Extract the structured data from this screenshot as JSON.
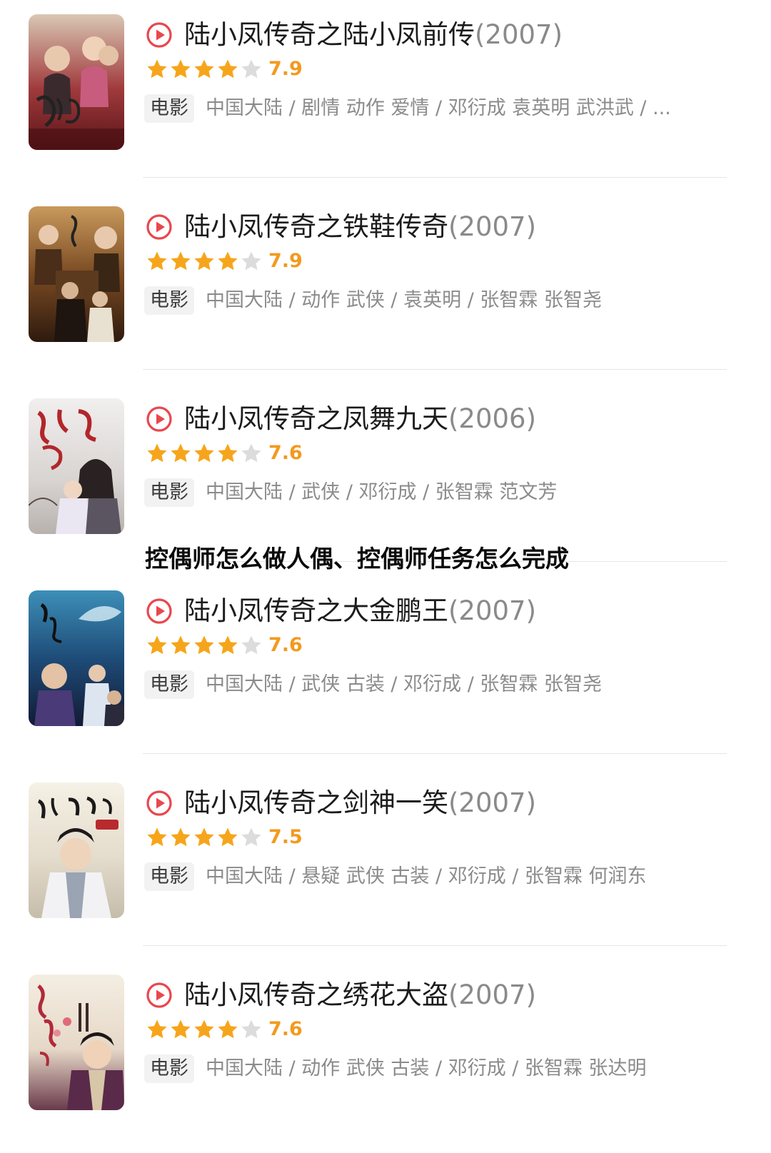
{
  "overlay_heading": "控偶师怎么做人偶、控偶师任务怎么完成",
  "colors": {
    "accent_play": "#e9474c",
    "star_filled": "#f6a51b",
    "star_empty": "#dcdcdc",
    "rating_text": "#f39a1e"
  },
  "icons": {
    "play": "play-circle-icon",
    "star": "star-icon"
  },
  "movies": [
    {
      "title": "陆小凤传奇之陆小凤前传",
      "year": "(2007)",
      "stars_filled": 4,
      "stars_total": 5,
      "rating": "7.9",
      "type": "电影",
      "meta": "中国大陆 / 剧情 动作 爱情 / 邓衍成 袁英明 武洪武 / ..."
    },
    {
      "title": "陆小凤传奇之铁鞋传奇",
      "year": "(2007)",
      "stars_filled": 4,
      "stars_total": 5,
      "rating": "7.9",
      "type": "电影",
      "meta": "中国大陆 / 动作 武侠 / 袁英明 / 张智霖 张智尧"
    },
    {
      "title": "陆小凤传奇之凤舞九天",
      "year": "(2006)",
      "stars_filled": 4,
      "stars_total": 5,
      "rating": "7.6",
      "type": "电影",
      "meta": "中国大陆 / 武侠 / 邓衍成 / 张智霖 范文芳"
    },
    {
      "title": "陆小凤传奇之大金鹏王",
      "year": "(2007)",
      "stars_filled": 4,
      "stars_total": 5,
      "rating": "7.6",
      "type": "电影",
      "meta": "中国大陆 / 武侠 古装 / 邓衍成 / 张智霖 张智尧"
    },
    {
      "title": "陆小凤传奇之剑神一笑",
      "year": "(2007)",
      "stars_filled": 4,
      "stars_total": 5,
      "rating": "7.5",
      "type": "电影",
      "meta": "中国大陆 / 悬疑 武侠 古装 / 邓衍成 / 张智霖 何润东"
    },
    {
      "title": "陆小凤传奇之绣花大盗",
      "year": "(2007)",
      "stars_filled": 4,
      "stars_total": 5,
      "rating": "7.6",
      "type": "电影",
      "meta": "中国大陆 / 动作 武侠 古装 / 邓衍成 / 张智霖 张达明"
    }
  ]
}
